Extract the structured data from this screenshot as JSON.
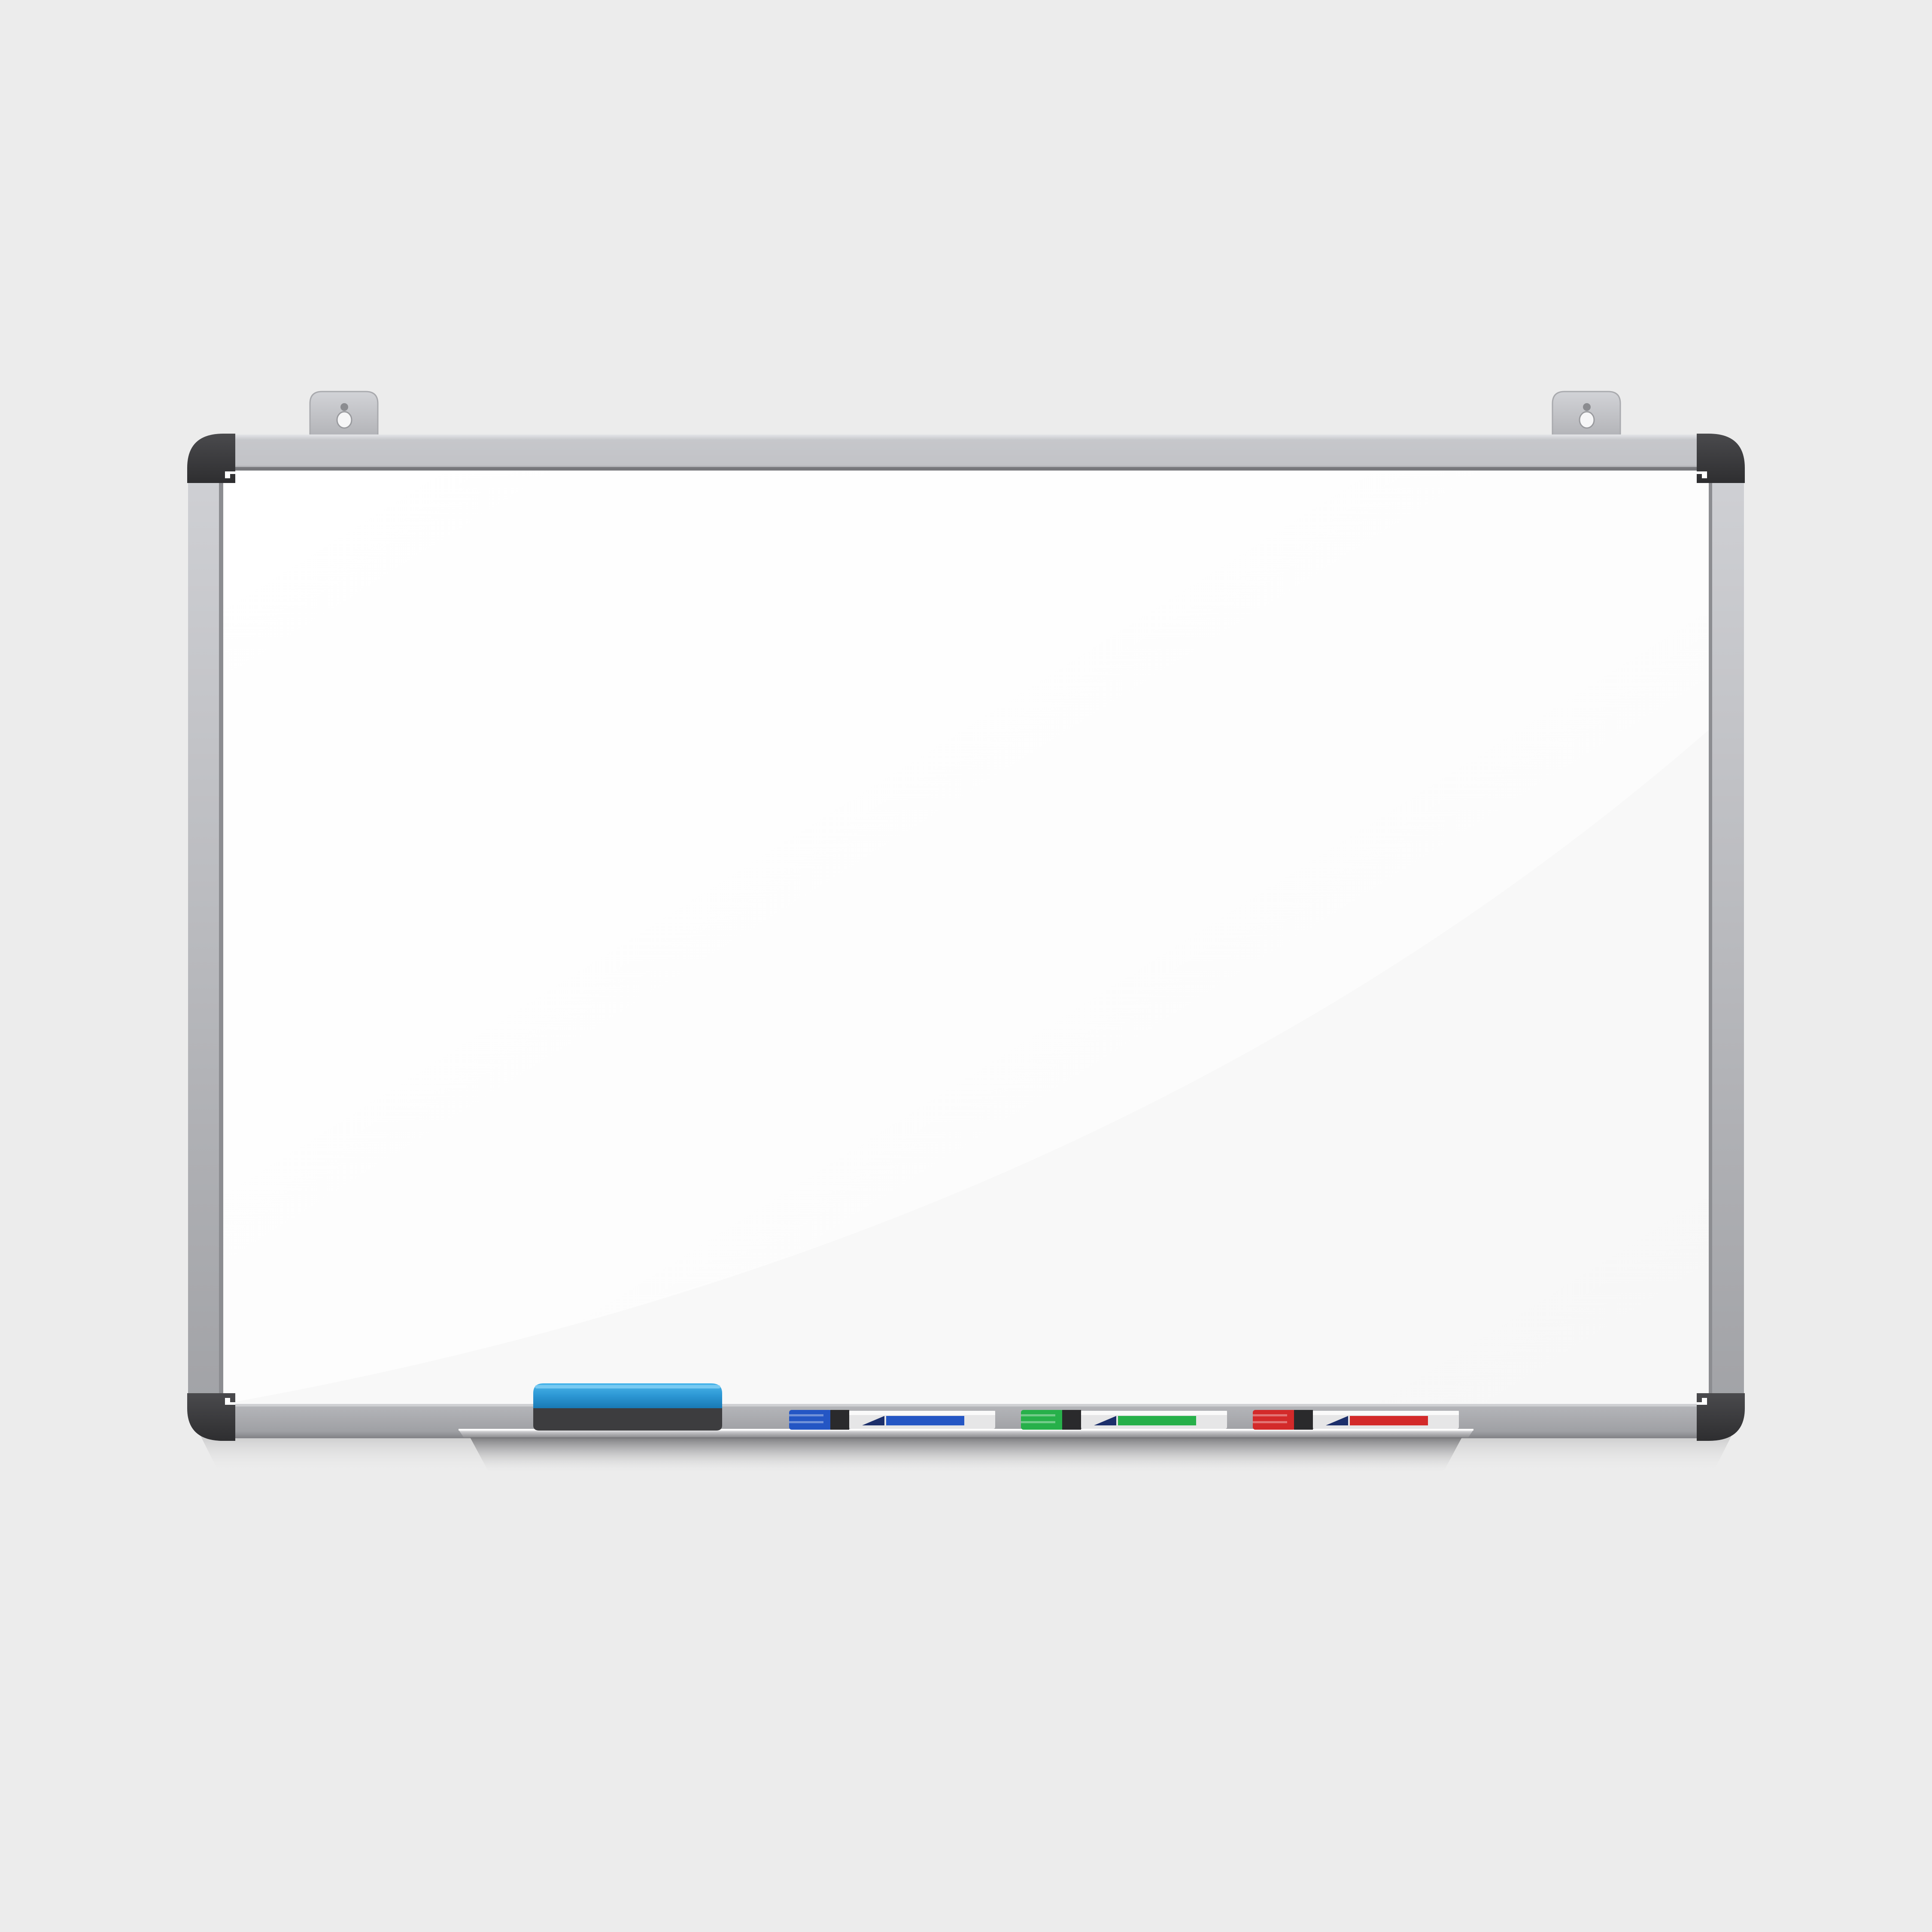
{
  "colors": {
    "background": "#ececec",
    "frame_light": "#c9c9cd",
    "frame_dark": "#9d9ea2",
    "frame_edge": "#7f8084",
    "corner_caps": "#3a3a3c",
    "board_surface": "#ffffff",
    "hanger": "#c4c5c9",
    "eraser_top": "#3aa3dc",
    "eraser_base": "#3d3d3f",
    "tray": "#bdbdc0"
  },
  "hangers": [
    {
      "name": "left-hanger"
    },
    {
      "name": "right-hanger"
    }
  ],
  "eraser": {
    "top_color": "#3aa3dc",
    "bottom_color": "#1a7fb9",
    "base_color": "#3d3d3f"
  },
  "markers": [
    {
      "name": "blue-marker",
      "color": "#2456c4",
      "dark": "#1a3f96"
    },
    {
      "name": "green-marker",
      "color": "#27b04a",
      "dark": "#1b8a36"
    },
    {
      "name": "red-marker",
      "color": "#d32a2a",
      "dark": "#a81c1c"
    }
  ]
}
